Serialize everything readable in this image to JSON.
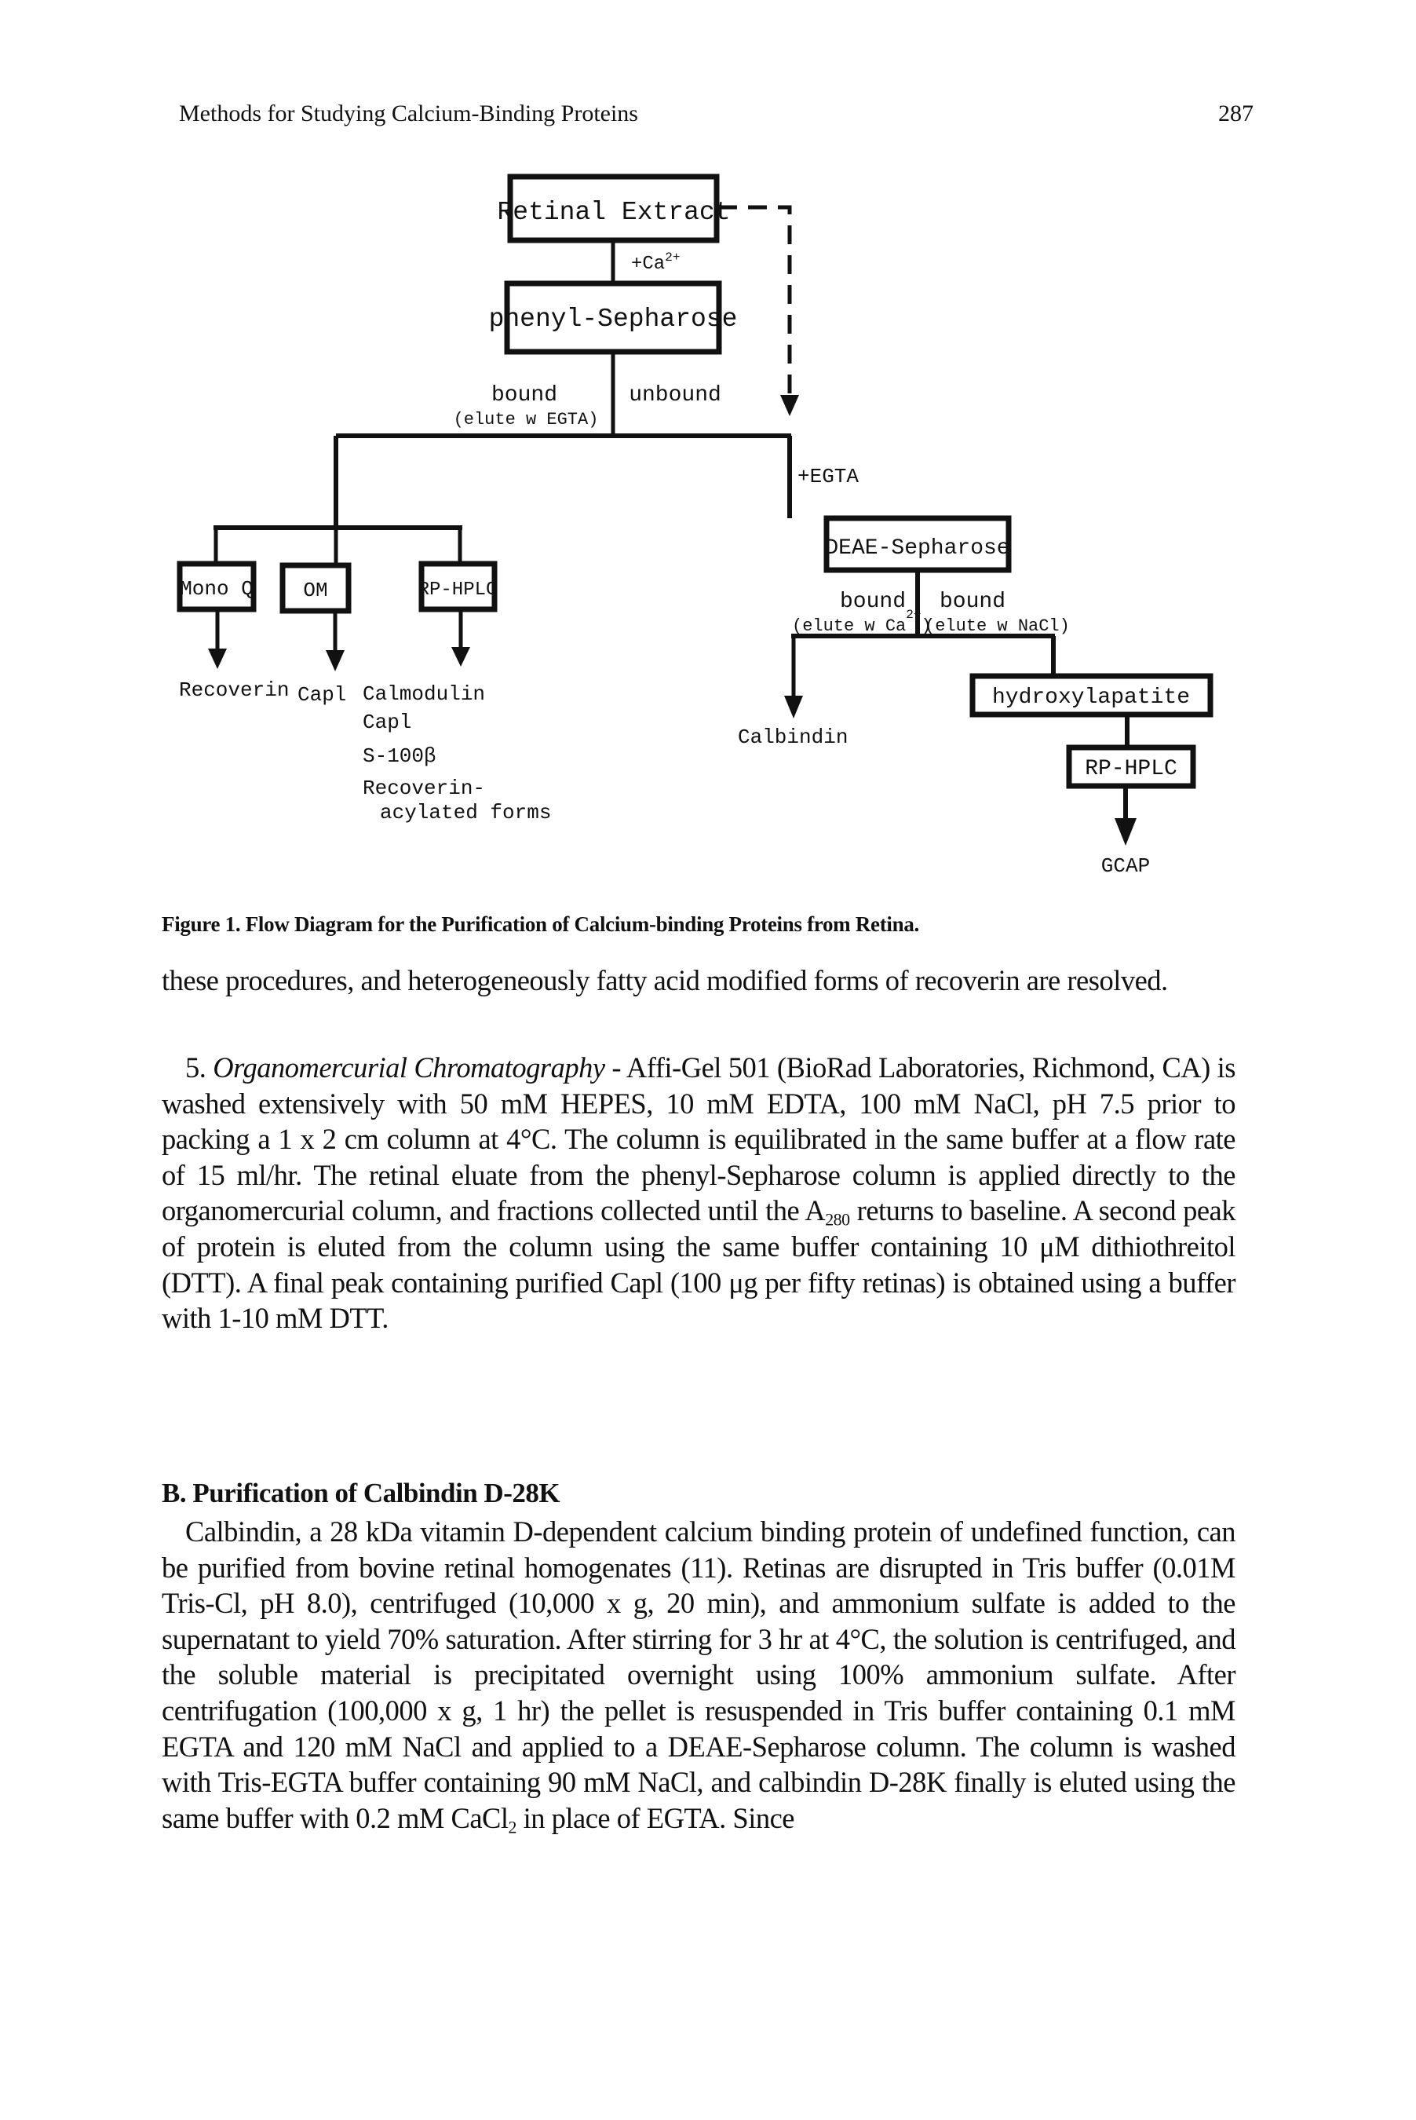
{
  "header": {
    "running_title": "Methods for Studying Calcium-Binding Proteins",
    "page_number": "287"
  },
  "figure": {
    "nodes": {
      "retinal_extract": "Retinal Extract",
      "phenyl_sepharose": "phenyl-Sepharose",
      "mono_q": "Mono Q",
      "om": "OM",
      "rp_hplc_1": "RP-HPLC",
      "deae_sepharose": "DEAE-Sepharose",
      "hydroxylapatite": "hydroxylapatite",
      "rp_hplc_2": "RP-HPLC"
    },
    "labels": {
      "plus_ca": "+Ca",
      "plus_ca_sup": "2+",
      "bound_1": "bound",
      "elute_egta": "(elute w EGTA)",
      "unbound": "unbound",
      "plus_egta": "+EGTA",
      "bound_2": "bound",
      "elute_ca": "(elute w Ca",
      "elute_ca_sup": "2+",
      "elute_ca_close": ")",
      "bound_3": "bound",
      "elute_nacl": "(elute w NaCl)"
    },
    "products": {
      "recoverin": "Recoverin",
      "capl_om": "Capl",
      "rp_list": [
        "Calmodulin",
        "Capl",
        "S-100β",
        "Recoverin-",
        "acylated forms"
      ],
      "calbindin": "Calbindin",
      "gcap": "GCAP"
    },
    "caption": "Figure 1.  Flow Diagram for the Purification of Calcium-binding Proteins from Retina."
  },
  "body": {
    "para1": "these procedures, and heterogeneously fatty acid modified forms of recoverin are resolved.",
    "para2": {
      "number": "5. ",
      "title_italic": "Organomercurial Chromatography",
      "text_a": " - Affi-Gel 501 (BioRad Laboratories, Richmond, CA) is washed extensively with 50 mM HEPES, 10 mM EDTA, 100 mM NaCl, pH 7.5 prior to packing a 1 x 2 cm column at 4°C.  The column is equilibrated in the same buffer at a flow rate of 15 ml/hr. The retinal eluate from the phenyl-Sepharose column is applied directly to the organomercurial column, and fractions collected until the A",
      "text_sub": "280",
      "text_b": " returns to baseline.  A second peak of protein is eluted from the column using the same buffer containing 10 μM dithiothreitol (DTT).  A final peak containing purified Capl (100 μg per fifty retinas) is obtained using a buffer with 1-10 mM DTT."
    },
    "section_b_heading": "B.  Purification of Calbindin D-28K",
    "para3": {
      "text_a": "Calbindin, a 28 kDa vitamin D-dependent calcium binding protein of undefined function, can be purified from bovine retinal homogenates (11). Retinas are disrupted in Tris buffer (0.01M Tris-Cl, pH 8.0), centrifuged (10,000 x g, 20 min), and ammonium sulfate is added to the supernatant to yield 70% saturation.  After stirring for 3 hr at 4°C, the solution is centrifuged, and the soluble material is precipitated overnight using 100% ammonium sulfate.  After centrifugation (100,000 x g, 1 hr) the pellet is resuspended in Tris buffer containing 0.1 mM EGTA and 120 mM NaCl and applied to a DEAE-Sepharose column.  The column is washed with Tris-EGTA buffer containing 90 mM NaCl, and calbindin D-28K finally is eluted using the same buffer with 0.2 mM CaCl",
      "text_sub": "2",
      "text_b": " in place of EGTA.  Since"
    }
  }
}
